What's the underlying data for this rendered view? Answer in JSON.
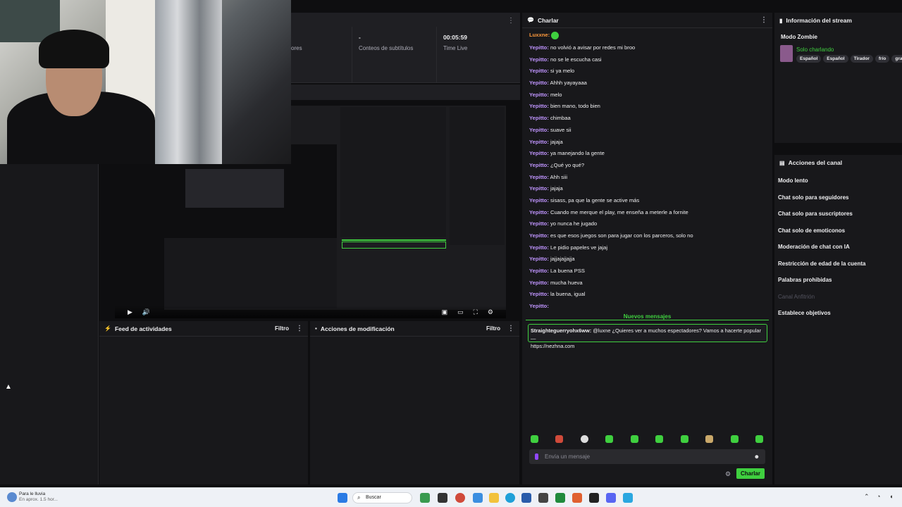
{
  "stats": {
    "item1_label": "ores",
    "item2_value": "-",
    "item2_label": "Conteos de subtítulos",
    "item3_value": "00:05:59",
    "item3_label": "Time Live"
  },
  "chat": {
    "title": "Charlar",
    "first_user": "Luxxne:",
    "messages": [
      {
        "user": "Yepitto:",
        "text": "no volvió a avisar por redes mi broo"
      },
      {
        "user": "Yepitto:",
        "text": "no se le escucha casi"
      },
      {
        "user": "Yepitto:",
        "text": "si ya melo"
      },
      {
        "user": "Yepitto:",
        "text": "Ahhh yayayaaa"
      },
      {
        "user": "Yepitto:",
        "text": "melo"
      },
      {
        "user": "Yepitto:",
        "text": "bien mano, todo bien"
      },
      {
        "user": "Yepitto:",
        "text": "chimbaa"
      },
      {
        "user": "Yepitto:",
        "text": "suave sii"
      },
      {
        "user": "Yepitto:",
        "text": "jajaja"
      },
      {
        "user": "Yepitto:",
        "text": "ya manejando la gente"
      },
      {
        "user": "Yepitto:",
        "text": "¿Qué yo qué?"
      },
      {
        "user": "Yepitto:",
        "text": "Ahh siii"
      },
      {
        "user": "Yepitto:",
        "text": "jajaja"
      },
      {
        "user": "Yepitto:",
        "text": "sisass, pa que la gente se active más"
      },
      {
        "user": "Yepitto:",
        "text": "Cuando me merque el play, me enseña a meterle a fornite"
      },
      {
        "user": "Yepitto:",
        "text": "yo nunca he jugado"
      },
      {
        "user": "Yepitto:",
        "text": "es que esos juegos son para jugar con los parceros, solo no"
      },
      {
        "user": "Yepitto:",
        "text": "Le pidio papeles ve jajaj"
      },
      {
        "user": "Yepitto:",
        "text": "jajjajajjajja"
      },
      {
        "user": "Yepitto:",
        "text": "La buena PSS"
      },
      {
        "user": "Yepitto:",
        "text": "mucha hueva"
      },
      {
        "user": "Yepitto:",
        "text": "la buena, igual"
      },
      {
        "user": "Yepitto:",
        "text": ""
      }
    ],
    "new_messages_label": "Nuevos mensajes",
    "pinned_user": "Straighteguerryohx6ww:",
    "pinned_text": "@luxne ¿Quieres ver a muchos espectadores? Vamos a hacerte popular —",
    "pinned_link": "https://nezhna.com",
    "input_placeholder": "Envía un mensaje",
    "send_label": "Charlar"
  },
  "info": {
    "title": "Información del stream",
    "stream_title": "Modo Zombie",
    "category": "Solo charlando",
    "tags": [
      "Español",
      "Español",
      "Tirador",
      "frío",
      "gra"
    ]
  },
  "actions": {
    "title": "Acciones del canal",
    "items": [
      {
        "label": "Modo lento",
        "enabled": true
      },
      {
        "label": "Chat solo para seguidores",
        "enabled": true
      },
      {
        "label": "Chat solo para suscriptores",
        "enabled": true
      },
      {
        "label": "Chat solo de emoticonos",
        "enabled": true
      },
      {
        "label": "Moderación de chat con IA",
        "enabled": true
      },
      {
        "label": "Restricción de edad de la cuenta",
        "enabled": true
      },
      {
        "label": "Palabras prohibidas",
        "enabled": true
      },
      {
        "label": "Canal Anfitrión",
        "enabled": false
      },
      {
        "label": "Establece objetivos",
        "enabled": true
      }
    ]
  },
  "feed": {
    "title": "Feed de actividades",
    "filter": "Filtro"
  },
  "mods": {
    "title": "Acciones de modificación",
    "filter": "Filtro"
  },
  "taskbar": {
    "weather_title": "Para le lluvia",
    "weather_sub": "En aprox. 1.5 hor...",
    "search_label": "Buscar"
  },
  "colors": {
    "accent": "#3fcf3f",
    "username": "#bf94ff",
    "first_user": "#ff9a3c"
  }
}
